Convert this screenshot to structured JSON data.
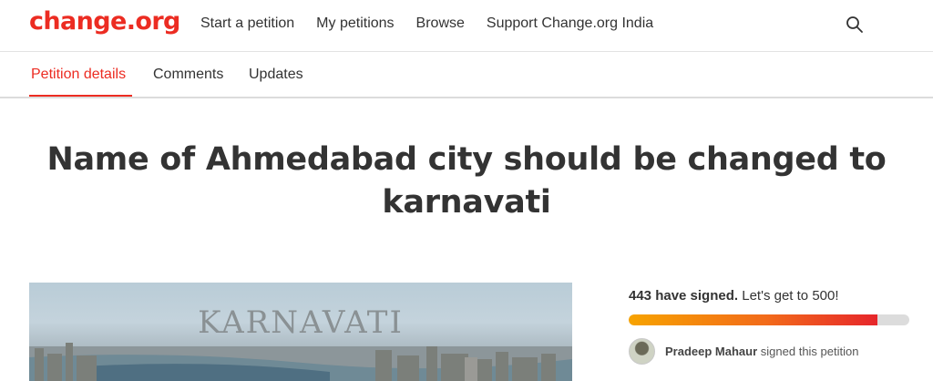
{
  "header": {
    "logo": "change.org",
    "nav": [
      "Start a petition",
      "My petitions",
      "Browse",
      "Support Change.org India"
    ],
    "search_icon": "search-icon",
    "brand_color": "#ec2c22"
  },
  "tabs": [
    {
      "label": "Petition details",
      "active": true
    },
    {
      "label": "Comments",
      "active": false
    },
    {
      "label": "Updates",
      "active": false
    }
  ],
  "petition": {
    "title_line1": "Name of Ahmedabad city should be changed to",
    "title_line2": "karnavati",
    "image_caption": "KARNAVATI"
  },
  "signatures": {
    "count_text": "443 have signed.",
    "goal_text": "Let's get to 500!",
    "signed": 443,
    "goal": 500,
    "progress_fraction": 0.886,
    "recent_signer": "Pradeep Mahaur",
    "recent_signer_suffix": "signed this petition"
  }
}
